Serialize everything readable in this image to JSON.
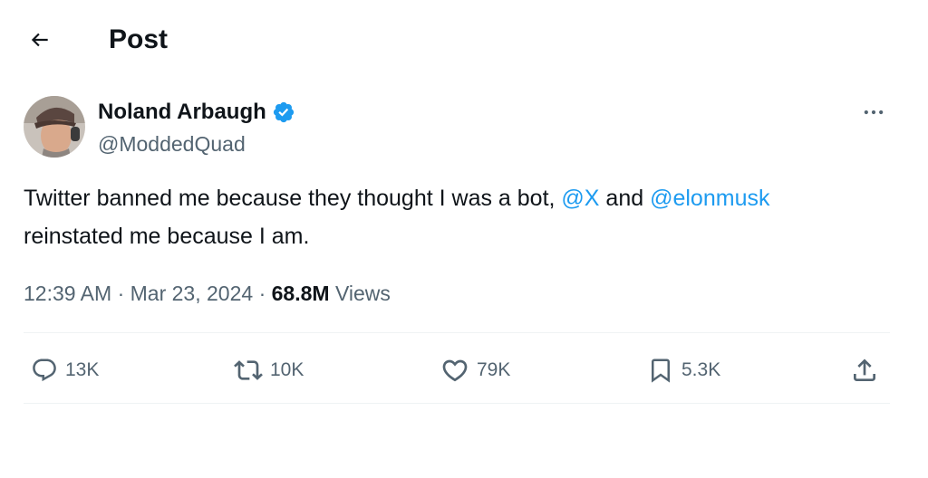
{
  "header": {
    "title": "Post",
    "back_icon": "arrow-left-icon"
  },
  "author": {
    "name": "Noland Arbaugh",
    "handle": "@ModdedQuad",
    "verified": true,
    "verified_color": "#1d9bf0",
    "avatar_icon": "profile-photo"
  },
  "tweet": {
    "text_1": "Twitter banned me because they thought I was a bot, ",
    "mention_1": "@X",
    "text_2": " and ",
    "mention_2": "@elonmusk",
    "text_3": "reinstated me because I am.",
    "mention_color": "#1d9bf0"
  },
  "meta": {
    "time": "12:39 AM",
    "separator": "·",
    "date": "Mar 23, 2024",
    "views_count": "68.8M",
    "views_label": "Views"
  },
  "actions": {
    "reply": {
      "count": "13K",
      "icon": "reply-icon"
    },
    "repost": {
      "count": "10K",
      "icon": "repost-icon"
    },
    "like": {
      "count": "79K",
      "icon": "heart-icon"
    },
    "bookmark": {
      "count": "5.3K",
      "icon": "bookmark-icon"
    },
    "share": {
      "icon": "share-icon"
    }
  }
}
